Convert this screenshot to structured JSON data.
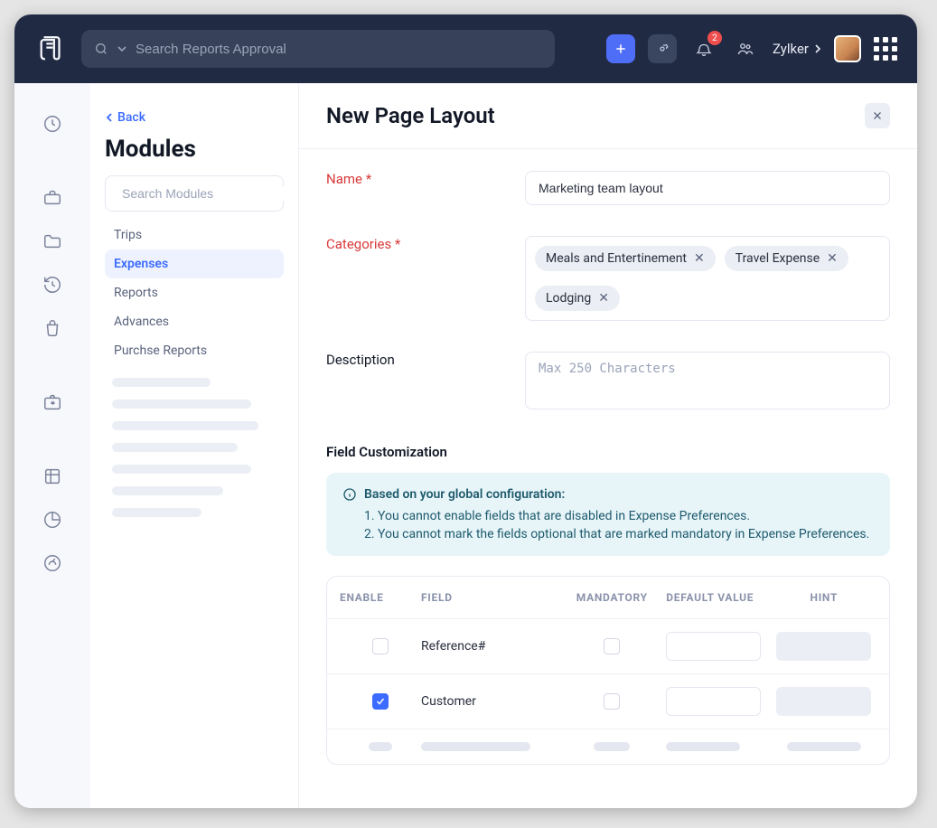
{
  "topbar": {
    "search_placeholder": "Search Reports Approval",
    "org_name": "Zylker",
    "notification_count": "2"
  },
  "modules": {
    "back_label": "Back",
    "title": "Modules",
    "search_placeholder": "Search Modules",
    "items": [
      "Trips",
      "Expenses",
      "Reports",
      "Advances",
      "Purchse Reports"
    ],
    "active_index": 1
  },
  "main": {
    "title": "New Page Layout",
    "labels": {
      "name": "Name *",
      "categories": "Categories *",
      "description": "Desctiption",
      "field_custom": "Field Customization"
    },
    "name_value": "Marketing team layout",
    "category_chips": [
      "Meals and Entertinement",
      "Travel Expense",
      "Lodging"
    ],
    "description_placeholder": "Max 250 Characters",
    "info": {
      "head": "Based on your global configuration:",
      "rules": [
        "1. You cannot enable fields that are disabled in Expense Preferences.",
        "2. You cannot mark the fields optional that are marked mandatory in Expense Preferences."
      ]
    },
    "table": {
      "headers": [
        "ENABLE",
        "FIELD",
        "MANDATORY",
        "DEFAULT VALUE",
        "HINT"
      ],
      "rows": [
        {
          "enabled": false,
          "field": "Reference#",
          "mandatory": false
        },
        {
          "enabled": true,
          "field": "Customer",
          "mandatory": false
        }
      ]
    }
  }
}
